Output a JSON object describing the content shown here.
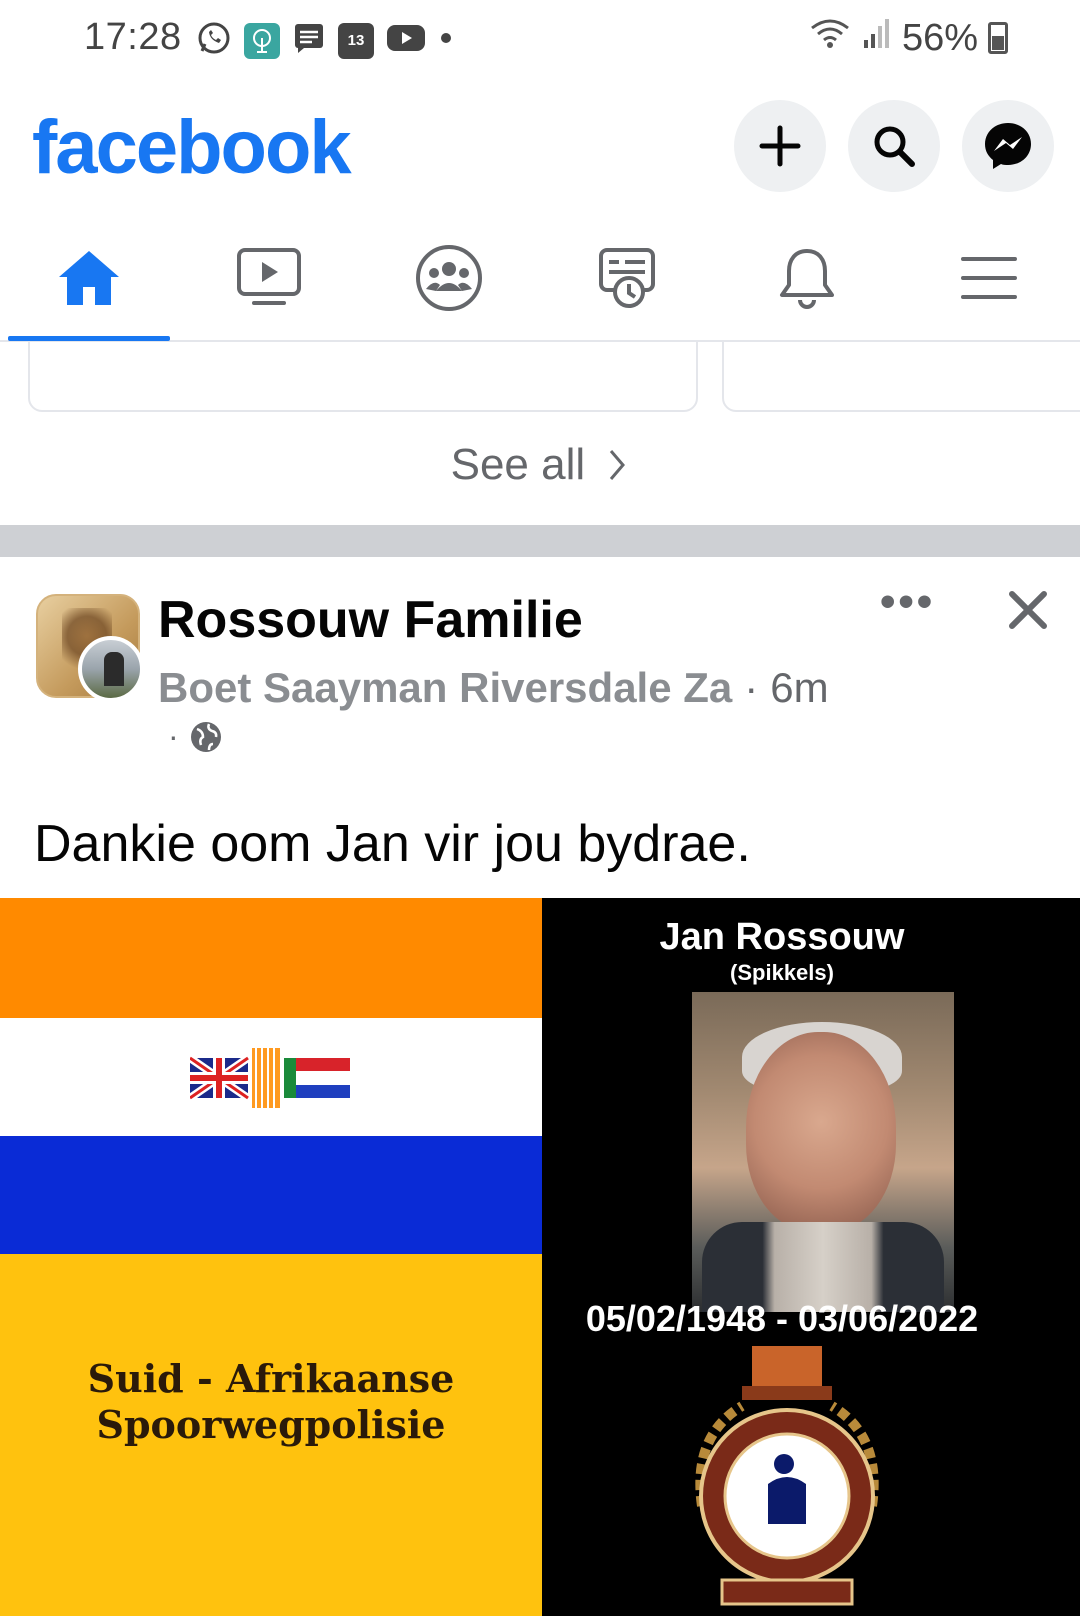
{
  "status_bar": {
    "time": "17:28",
    "calendar_date": "13",
    "battery": "56%",
    "icons": [
      "whatsapp-icon",
      "tree-app-icon",
      "message-icon",
      "calendar-icon",
      "youtube-icon",
      "dot-icon"
    ]
  },
  "header": {
    "logo": "facebook",
    "buttons": [
      "create-icon",
      "search-icon",
      "messenger-icon"
    ],
    "brand_color": "#1877f2"
  },
  "nav": {
    "tabs": [
      "home",
      "watch",
      "groups",
      "memories",
      "notifications",
      "menu"
    ],
    "active": "home"
  },
  "suggestions": {
    "see_all": "See all"
  },
  "post": {
    "group_name": "Rossouw Familie",
    "author": "Boet Saayman Riversdale Za",
    "time": "6m",
    "privacy_icon": "globe-icon",
    "text": "Dankie oom Jan vir jou bydrae.",
    "image": {
      "flag_caption_line1": "Suid - Afrikaanse",
      "flag_caption_line2": "Spoorwegpolisie",
      "memorial_name": "Jan Rossouw",
      "memorial_nickname": "(Spikkels)",
      "memorial_dates": "05/02/1948 - 03/06/2022",
      "flag_colors": [
        "#ff8a00",
        "#ffffff",
        "#0a2bd6",
        "#ffc20e"
      ]
    }
  }
}
